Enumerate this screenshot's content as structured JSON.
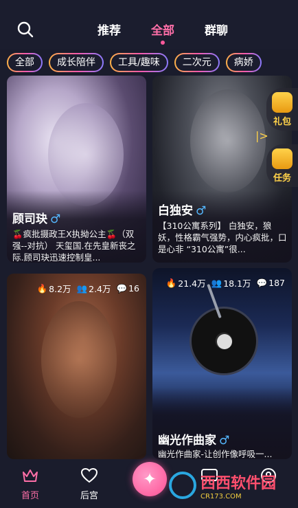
{
  "header": {
    "search_icon": "search-icon",
    "tabs": [
      {
        "label": "推荐",
        "active": false
      },
      {
        "label": "全部",
        "active": true
      },
      {
        "label": "群聊",
        "active": false
      }
    ]
  },
  "chips": [
    "全部",
    "成长陪伴",
    "工具/趣味",
    "二次元",
    "病娇"
  ],
  "cards": [
    {
      "name": "顾司玦",
      "gender_icon": "♂",
      "desc": "🍒疯批摄政王X执拗公主🍒（双强--对抗） 天玺国.在先皇新丧之际.顾司玦迅速控制皇...",
      "stats": null
    },
    {
      "name": "白独安",
      "gender_icon": "♂",
      "desc": "【310公寓系列】 白独安，狼妖，性格霸气强势，内心疯批，口是心非 “310公寓”很...",
      "stats": null
    },
    {
      "name": "",
      "gender_icon": "",
      "desc": "",
      "stats": {
        "fire": "8.2万",
        "users": "2.4万",
        "comments": "16"
      }
    },
    {
      "name": "幽光作曲家",
      "gender_icon": "♂",
      "desc": "幽光作曲家-让创作像呼吸一...",
      "stats": {
        "fire": "21.4万",
        "users": "18.1万",
        "comments": "187"
      }
    }
  ],
  "side": {
    "gift_label": "礼包",
    "task_label": "任务",
    "expand_symbol": "|>"
  },
  "nav": {
    "home": "首页",
    "harem": "后宫",
    "center_symbol": "✦",
    "watermark_text": "西西软件园",
    "watermark_sub": "CR173.COM"
  },
  "colors": {
    "accent": "#ff6fa8",
    "background": "#1a1c2c",
    "male_blue": "#55b8ff",
    "gold": "#ffd24a"
  }
}
